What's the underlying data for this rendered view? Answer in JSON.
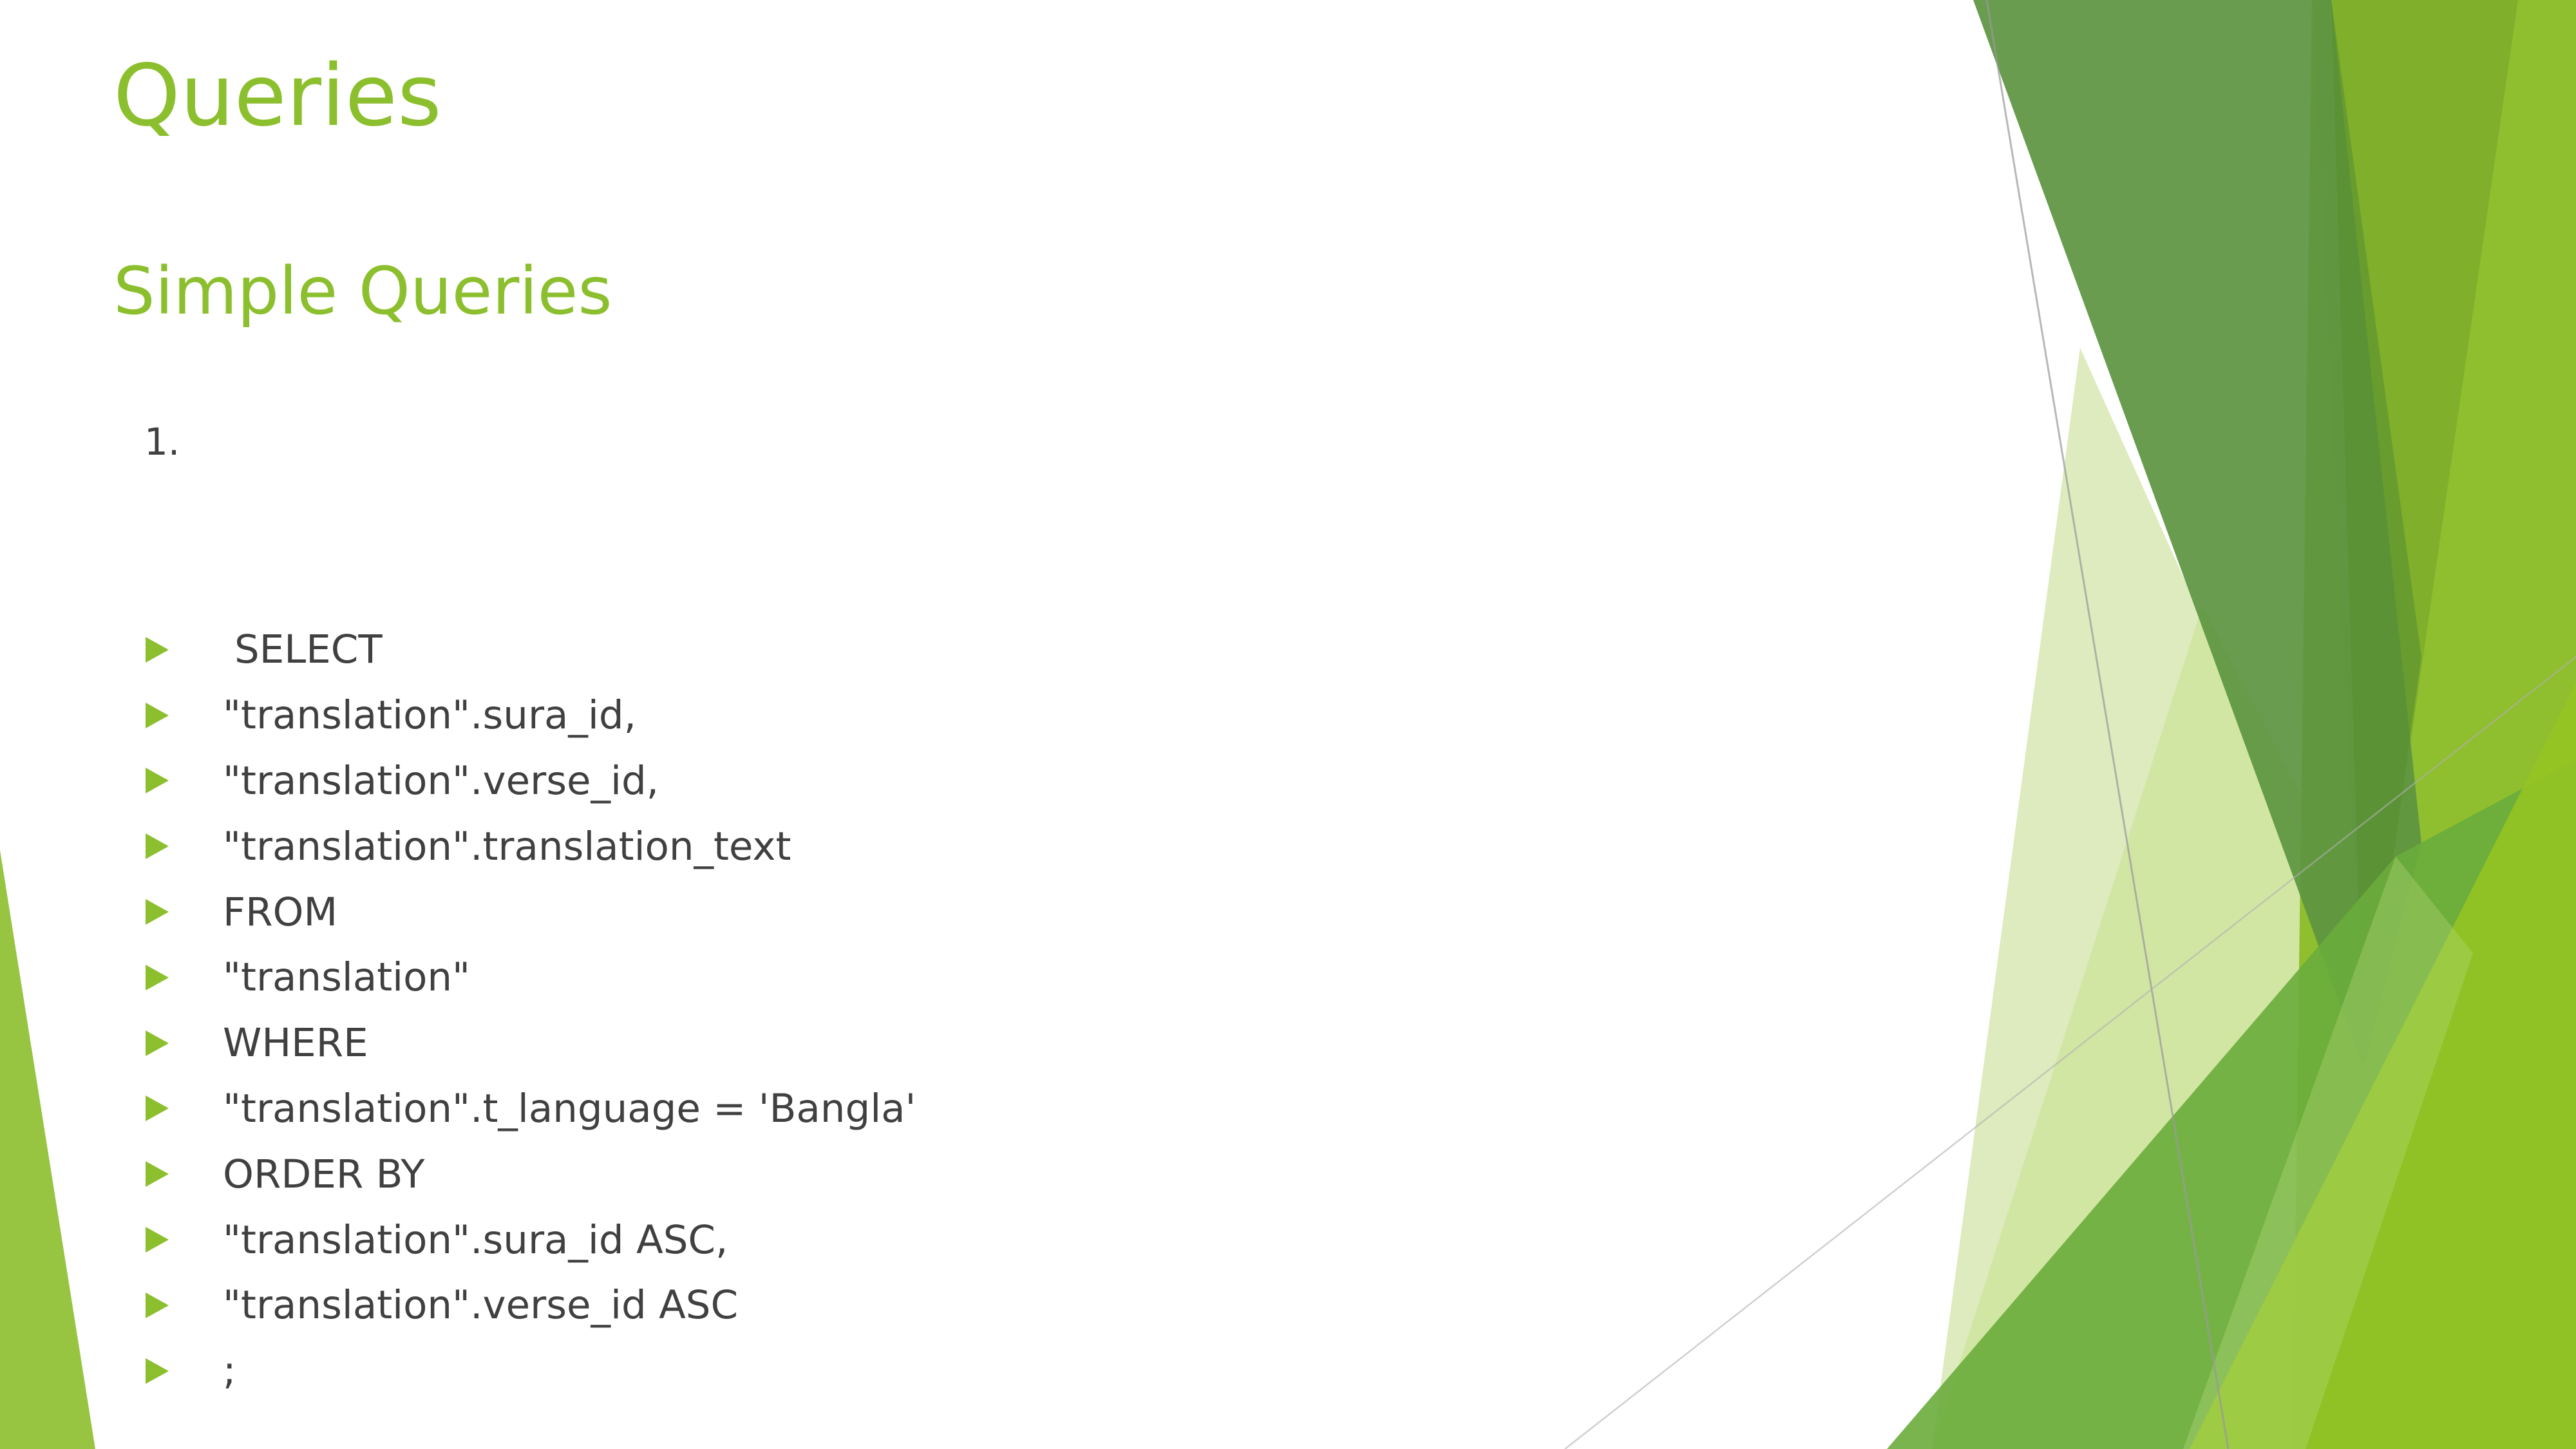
{
  "slide": {
    "title": "Queries",
    "subtitle": "Simple Queries",
    "item_number": "1.",
    "code_lines": [
      " SELECT",
      "\"translation\".sura_id,",
      "\"translation\".verse_id,",
      "\"translation\".translation_text",
      "FROM",
      "\"translation\"",
      "WHERE",
      "\"translation\".t_language = 'Bangla'",
      "ORDER BY",
      "\"translation\".sura_id ASC,",
      "\"translation\".verse_id ASC",
      ";"
    ]
  },
  "theme": {
    "accent": "#8cbf2e",
    "text": "#404040",
    "background": "#ffffff"
  }
}
